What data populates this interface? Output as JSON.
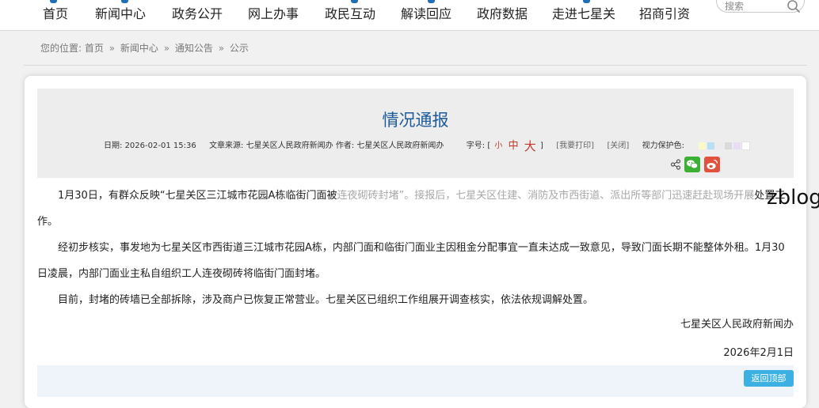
{
  "nav": {
    "items": [
      "首页",
      "新闻中心",
      "政务公开",
      "网上办事",
      "政民互动",
      "解读回应",
      "政府数据",
      "走进七星关",
      "招商引资"
    ],
    "search_placeholder": "搜索"
  },
  "breadcrumb": {
    "prefix": "您的位置:",
    "items": [
      "首页",
      "新闻中心",
      "通知公告",
      "公示"
    ],
    "separator": "»"
  },
  "article": {
    "title": "情况通报",
    "meta": {
      "date_label": "日期:",
      "date": "2026-02-01 15:36",
      "source_label": "文章来源:",
      "source": "七星关区人民政府新闻办",
      "author_label": "作者:",
      "author": "七星关区人民政府新闻办",
      "font_size_label": "字号:",
      "bracket_open": "[",
      "font_small": "小",
      "font_medium": "中",
      "font_large": "大",
      "bracket_close": "]",
      "print_link": "[我要打印]",
      "close_link": "[关闭]",
      "vision_label": "视力保护色:"
    },
    "vision_colors": [
      "#fafac8",
      "#b7e0f5",
      "#ececec",
      "#dadada",
      "#e8ddf5",
      "#ffffff"
    ],
    "paragraphs": {
      "p1_main": "1月30日，有群众反映“七星关区三江城市花园A栋临街门面被",
      "p1_faded": "连夜砌砖封堵”。接报后，七星关区住建、消防及市西街道、派出所等部门迅速赶赴现场开展",
      "p1_tail": "处置工作。",
      "p2": "经初步核实，事发地为七星关区市西街道三江城市花园A栋，内部门面和临街门面业主因租金分配事宜一直未达成一致意见，导致门面长期不能整体外租。1月30日凌晨，内部门面业主私自组织工人连夜砌砖将临街门面封堵。",
      "p3": "目前，封堵的砖墙已全部拆除，涉及商户已恢复正常营业。七星关区已组织工作组展开调查核实，依法依规调解处置。"
    },
    "signature": "七星关区人民政府新闻办",
    "date_line": "2026年2月1日",
    "back_to_top": "返回顶部"
  },
  "watermark": "zblog",
  "icons": {
    "search": "search-icon",
    "share": "share-icon",
    "wechat": "wechat-icon",
    "weibo": "weibo-icon"
  },
  "colors": {
    "title_blue": "#1d5a9a",
    "font_size_red": "#c0392b",
    "back_top_blue": "#3db0e3",
    "wechat_green": "#3cb034",
    "weibo_red": "#e0523d"
  }
}
